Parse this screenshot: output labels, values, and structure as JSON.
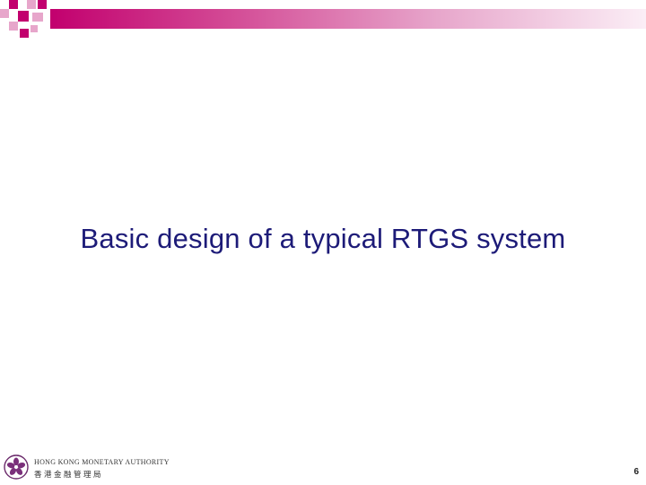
{
  "slide": {
    "title": "Basic design of a typical RTGS system",
    "page_number": "6"
  },
  "footer": {
    "org_name_en": "HONG KONG MONETARY AUTHORITY",
    "org_name_zh": "香港金融管理局"
  },
  "colors": {
    "accent_pink": "#c2006e",
    "light_pink": "#e7a6cb",
    "title_navy": "#1d1b78"
  },
  "icons": {
    "logo": "hkma-bauhinia-logo-icon"
  }
}
